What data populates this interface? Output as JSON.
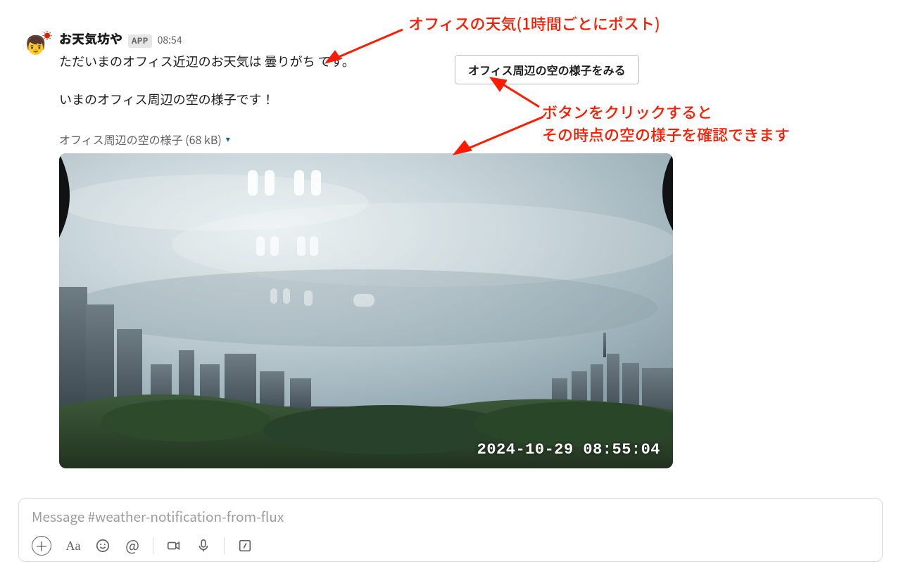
{
  "message": {
    "sender_name": "お天気坊や",
    "app_badge": "APP",
    "timestamp": "08:54",
    "line1": "ただいまのオフィス近辺のお天気は 曇りがち です。",
    "line2": "いまのオフィス周辺の空の様子です！",
    "attachment": {
      "title": "オフィス周辺の空の様子 (68 kB)",
      "overlay_timestamp": "2024-10-29 08:55:04"
    }
  },
  "button": {
    "label": "オフィス周辺の空の様子をみる"
  },
  "annotations": {
    "a1": "オフィスの天気(1時間ごとにポスト)",
    "a2": "ボタンをクリックすると\nその時点の空の様子を確認できます"
  },
  "composer": {
    "placeholder": "Message #weather-notification-from-flux"
  }
}
